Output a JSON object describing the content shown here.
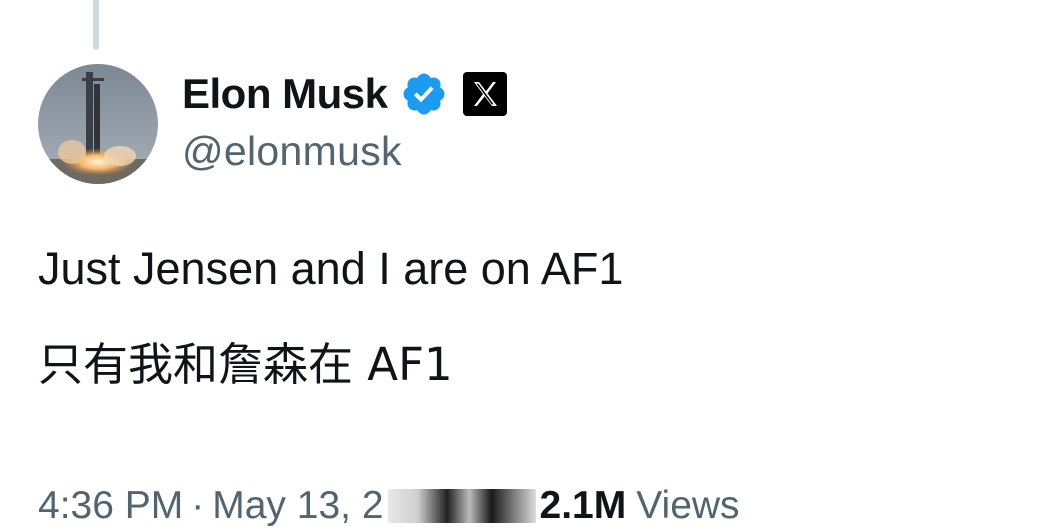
{
  "author": {
    "display_name": "Elon Musk",
    "handle": "@elonmusk",
    "verified_icon": "verified-badge-icon",
    "affiliate_icon": "x-logo-icon",
    "verified_color": "#1d9bf0"
  },
  "tweet": {
    "line1": "Just Jensen and I are on AF1",
    "line2": "只有我和詹森在 AF1"
  },
  "meta": {
    "time": "4:36 PM",
    "separator": "·",
    "date": "May 13, 2",
    "views_count": "2.1M",
    "views_label": "Views"
  }
}
